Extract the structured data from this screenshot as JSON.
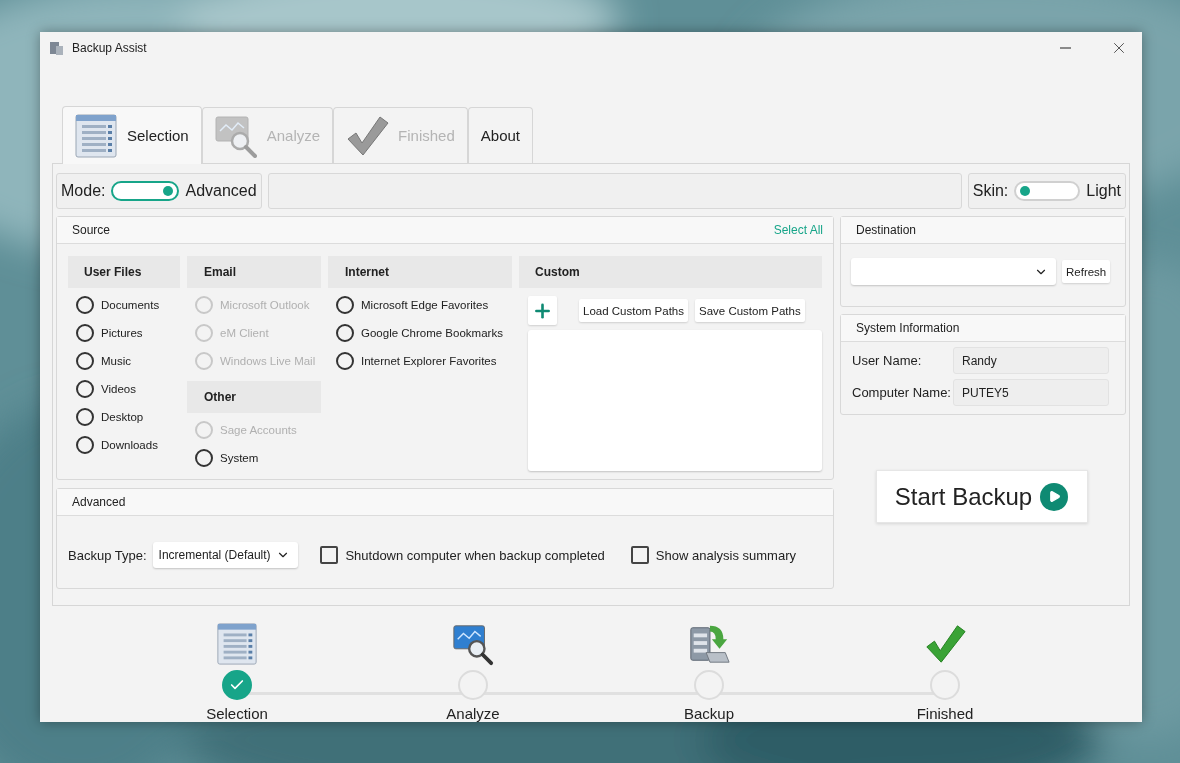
{
  "window": {
    "title": "Backup Assist"
  },
  "tabs": [
    {
      "label": "Selection",
      "selected": true,
      "disabled": false
    },
    {
      "label": "Analyze",
      "selected": false,
      "disabled": true
    },
    {
      "label": "Finished",
      "selected": false,
      "disabled": true
    },
    {
      "label": "About",
      "selected": false,
      "disabled": false
    }
  ],
  "mode": {
    "label": "Mode:",
    "value": "Advanced",
    "on": true
  },
  "skin": {
    "label": "Skin:",
    "value": "Light",
    "on": false
  },
  "source": {
    "title": "Source",
    "select_all": "Select All",
    "columns": [
      {
        "groups": [
          {
            "title": "User Files",
            "items": [
              {
                "label": "Documents",
                "checked": false,
                "disabled": false
              },
              {
                "label": "Pictures",
                "checked": false,
                "disabled": false
              },
              {
                "label": "Music",
                "checked": false,
                "disabled": false
              },
              {
                "label": "Videos",
                "checked": false,
                "disabled": false
              },
              {
                "label": "Desktop",
                "checked": false,
                "disabled": false
              },
              {
                "label": "Downloads",
                "checked": false,
                "disabled": false
              }
            ]
          }
        ]
      },
      {
        "groups": [
          {
            "title": "Email",
            "items": [
              {
                "label": "Microsoft Outlook",
                "checked": false,
                "disabled": true
              },
              {
                "label": "eM Client",
                "checked": false,
                "disabled": true
              },
              {
                "label": "Windows Live Mail",
                "checked": false,
                "disabled": true
              }
            ]
          },
          {
            "title": "Other",
            "items": [
              {
                "label": "Sage Accounts",
                "checked": false,
                "disabled": true
              },
              {
                "label": "System",
                "checked": false,
                "disabled": false
              }
            ]
          }
        ]
      },
      {
        "groups": [
          {
            "title": "Internet",
            "items": [
              {
                "label": "Microsoft Edge Favorites",
                "checked": false,
                "disabled": false
              },
              {
                "label": "Google Chrome Bookmarks",
                "checked": false,
                "disabled": false
              },
              {
                "label": "Internet Explorer Favorites",
                "checked": false,
                "disabled": false
              }
            ]
          }
        ]
      }
    ],
    "custom": {
      "title": "Custom",
      "buttons": [
        "Load Custom Paths",
        "Save Custom Paths"
      ]
    }
  },
  "destination": {
    "title": "Destination",
    "refresh": "Refresh"
  },
  "system_info": {
    "title": "System Information",
    "fields": [
      {
        "label": "User Name:",
        "value": "Randy"
      },
      {
        "label": "Computer Name:",
        "value": "PUTEY5"
      }
    ]
  },
  "start_button": "Start Backup",
  "advanced": {
    "title": "Advanced",
    "backup_type": {
      "label": "Backup Type:",
      "value": "Incremental (Default)"
    },
    "checkboxes": [
      {
        "label": "Shutdown computer when backup completed",
        "checked": false
      },
      {
        "label": "Show analysis summary",
        "checked": false
      }
    ]
  },
  "steps": [
    {
      "label": "Selection",
      "done": true
    },
    {
      "label": "Analyze",
      "done": false
    },
    {
      "label": "Backup",
      "done": false
    },
    {
      "label": "Finished",
      "done": false
    }
  ]
}
